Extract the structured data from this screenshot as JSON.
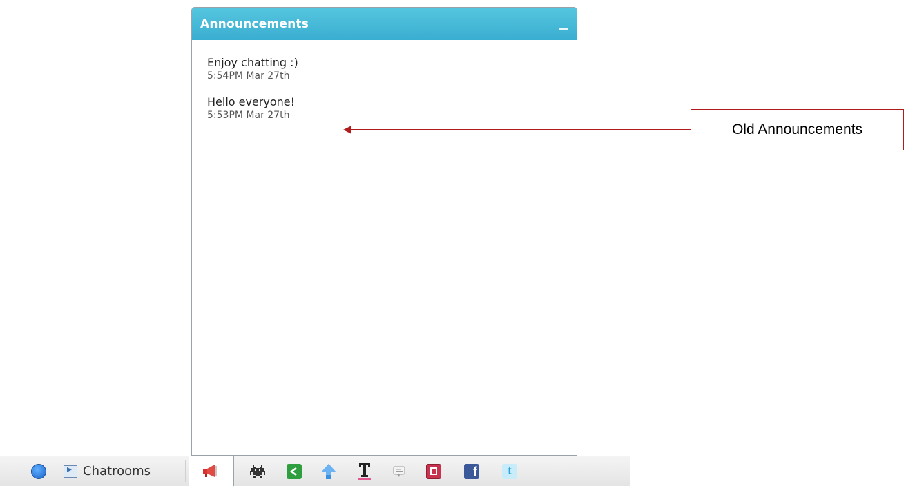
{
  "panel": {
    "title": "Announcements",
    "announcements": [
      {
        "text": "Enjoy chatting :)",
        "time": "5:54PM Mar 27th"
      },
      {
        "text": "Hello everyone!",
        "time": "5:53PM Mar 27th"
      }
    ]
  },
  "callout": {
    "label": "Old Announcements",
    "color": "#b01c1c"
  },
  "bottom_bar": {
    "chatrooms_label": "Chatrooms",
    "icons": [
      "home-globe-icon",
      "chatrooms-icon",
      "megaphone-icon",
      "space-invader-icon",
      "share-icon",
      "upload-arrow-icon",
      "text-format-icon",
      "chat-bubble-icon",
      "save-icon",
      "facebook-icon",
      "twitter-icon"
    ]
  },
  "colors": {
    "header": "#3aaed1",
    "accent_red": "#b01c1c"
  }
}
